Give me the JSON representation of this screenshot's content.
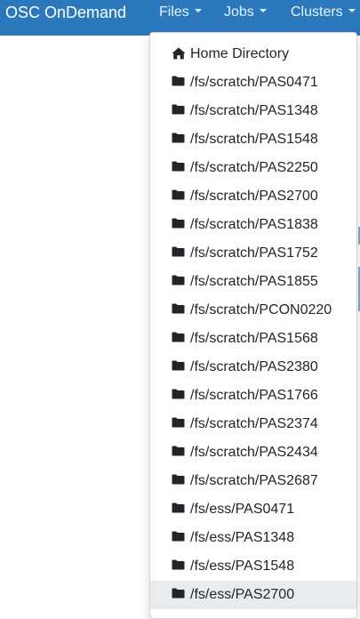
{
  "navbar": {
    "brand": "OSC OnDemand",
    "items": [
      {
        "id": "files",
        "label": "Files"
      },
      {
        "id": "jobs",
        "label": "Jobs"
      },
      {
        "id": "clusters",
        "label": "Clusters"
      }
    ],
    "background_color": "#2c78bd"
  },
  "files_menu": {
    "items": [
      {
        "label": "Home Directory",
        "icon": "home-icon"
      },
      {
        "label": "/fs/scratch/PAS0471",
        "icon": "folder-icon"
      },
      {
        "label": "/fs/scratch/PAS1348",
        "icon": "folder-icon"
      },
      {
        "label": "/fs/scratch/PAS1548",
        "icon": "folder-icon"
      },
      {
        "label": "/fs/scratch/PAS2250",
        "icon": "folder-icon"
      },
      {
        "label": "/fs/scratch/PAS2700",
        "icon": "folder-icon"
      },
      {
        "label": "/fs/scratch/PAS1838",
        "icon": "folder-icon"
      },
      {
        "label": "/fs/scratch/PAS1752",
        "icon": "folder-icon"
      },
      {
        "label": "/fs/scratch/PAS1855",
        "icon": "folder-icon"
      },
      {
        "label": "/fs/scratch/PCON0220",
        "icon": "folder-icon"
      },
      {
        "label": "/fs/scratch/PAS1568",
        "icon": "folder-icon"
      },
      {
        "label": "/fs/scratch/PAS2380",
        "icon": "folder-icon"
      },
      {
        "label": "/fs/scratch/PAS1766",
        "icon": "folder-icon"
      },
      {
        "label": "/fs/scratch/PAS2374",
        "icon": "folder-icon"
      },
      {
        "label": "/fs/scratch/PAS2434",
        "icon": "folder-icon"
      },
      {
        "label": "/fs/scratch/PAS2687",
        "icon": "folder-icon"
      },
      {
        "label": "/fs/ess/PAS0471",
        "icon": "folder-icon"
      },
      {
        "label": "/fs/ess/PAS1348",
        "icon": "folder-icon"
      },
      {
        "label": "/fs/ess/PAS1548",
        "icon": "folder-icon"
      },
      {
        "label": "/fs/ess/PAS2700",
        "icon": "folder-icon"
      }
    ],
    "hovered_item": "/fs/ess/PAS2700"
  }
}
